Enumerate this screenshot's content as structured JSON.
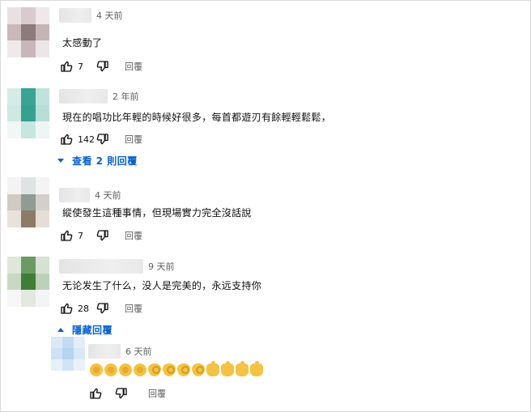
{
  "reply_label": "回覆",
  "comments": [
    {
      "time": "4 天前",
      "text": "太感動了",
      "likes": "7",
      "avatar_colors": [
        "#e8e0e2",
        "#d8cacd",
        "#efe7e9",
        "#cbb8bb",
        "#8d7a7d",
        "#c5b3b6",
        "#efe9ea",
        "#c8b7ba",
        "#ede6e8"
      ]
    },
    {
      "time": "2 年前",
      "text": "現在的唱功比年輕的時候好很多，每首都遊刃有餘輕輕鬆鬆，",
      "likes": "142",
      "avatar_colors": [
        "#d7ebe6",
        "#3aa393",
        "#bfe3dc",
        "#cfe8e2",
        "#35a190",
        "#b8ded6",
        "#f1f7f6",
        "#c7e6df",
        "#eef6f4"
      ]
    },
    {
      "time": "4 天前",
      "text": "縱使發生這種事情，但現場實力完全沒話說",
      "likes": "7",
      "avatar_colors": [
        "#f3f3f3",
        "#dfe3e3",
        "#f4f4f4",
        "#cfcbc4",
        "#8e9c93",
        "#d3d0cb",
        "#e7e2dc",
        "#8e7a68",
        "#e6ddd6"
      ]
    },
    {
      "time": "9 天前",
      "text": "无论发生了什么，没人是完美的，永远支持你",
      "likes": "28",
      "avatar_colors": [
        "#dfe6dc",
        "#6c9a64",
        "#d5e2d2",
        "#c8d8c4",
        "#3f7d38",
        "#bdd1b8",
        "#f7f7f7",
        "#e3e8e1",
        "#f4f4f4"
      ]
    }
  ],
  "view_replies": "查看 2 則回覆",
  "hide_replies": "隱藏回覆",
  "reply": {
    "time": "6 天前",
    "emoji_count": 12,
    "avatar_colors": [
      "#dbe9f6",
      "#c2dcf2",
      "#e4eef8",
      "#cfe2f4",
      "#b6d4ef",
      "#d9e8f6",
      "#e6f0f9",
      "#d2e4f4",
      "#e9f2fa"
    ]
  }
}
